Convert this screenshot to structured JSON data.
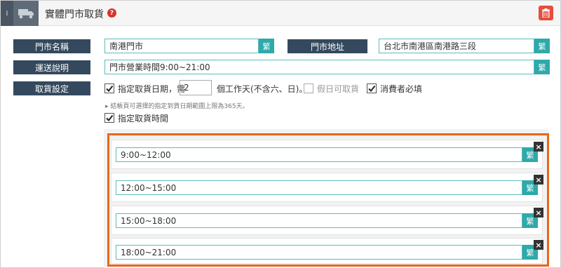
{
  "header": {
    "title": "實體門市取貨",
    "help_icon": "?"
  },
  "store_name": {
    "label": "門市名稱",
    "value": "南港門市",
    "translate": "繁"
  },
  "store_address": {
    "label": "門市地址",
    "value": "台北市南港區南港路三段",
    "translate": "繁"
  },
  "delivery_note": {
    "label": "運送說明",
    "value": "門市營業時間9:00~21:00",
    "translate": "繁"
  },
  "pickup": {
    "label": "取貨設定",
    "date_label": "指定取貨日期，需",
    "days_value": "2",
    "days_suffix": "個工作天(不含六、日)。",
    "holiday_label": "假日可取貨",
    "required_label": "消費者必填",
    "note": "▸ 結帳頁可選擇的指定到貨日期範圍上限為365天。",
    "time_label": "指定取貨時間"
  },
  "time_slots": [
    {
      "value": "9:00~12:00",
      "translate": "繁"
    },
    {
      "value": "12:00~15:00",
      "translate": "繁"
    },
    {
      "value": "15:00~18:00",
      "translate": "繁"
    },
    {
      "value": "18:00~21:00",
      "translate": "繁"
    }
  ],
  "colors": {
    "accent": "#2fa9a9",
    "label_bg": "#34495e",
    "highlight": "#e8671a",
    "danger": "#e74c3c"
  }
}
